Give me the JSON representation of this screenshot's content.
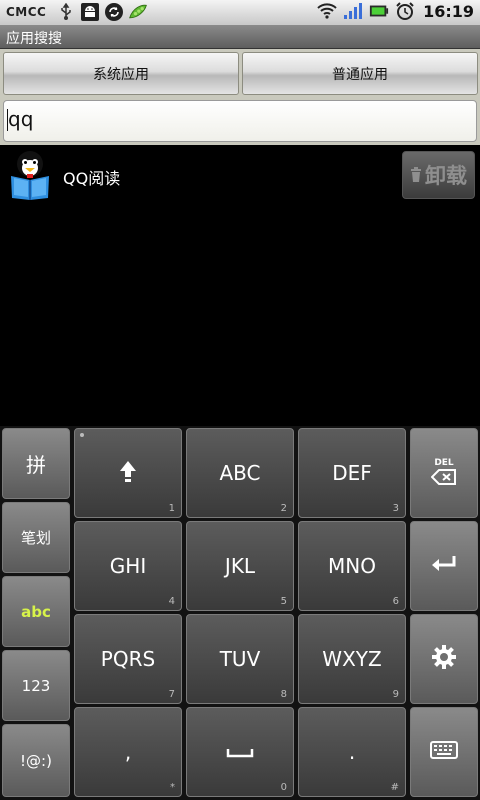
{
  "status_bar": {
    "carrier": "CMCC",
    "time": "16:19",
    "left_icons": [
      "usb-icon",
      "android-debug-icon",
      "sync-icon",
      "peapod-icon"
    ],
    "right_icons": [
      "wifi-icon",
      "signal-icon",
      "battery-icon",
      "alarm-icon"
    ]
  },
  "title_bar": {
    "title": "应用搜搜"
  },
  "tabs": [
    {
      "label": "系统应用"
    },
    {
      "label": "普通应用"
    }
  ],
  "search": {
    "value": "qq"
  },
  "results": [
    {
      "name": "QQ阅读",
      "icon": "qq-reader-icon",
      "action_label": "卸载",
      "action_icon": "trash-icon"
    }
  ],
  "keyboard": {
    "side_keys": [
      {
        "label": "拼"
      },
      {
        "label": "笔划"
      },
      {
        "label": "abc",
        "active": true
      },
      {
        "label": "123"
      },
      {
        "label": "!@:)"
      }
    ],
    "rows": [
      [
        {
          "label": "",
          "icon": "shift-icon",
          "sub": "1"
        },
        {
          "label": "ABC",
          "sub": "2"
        },
        {
          "label": "DEF",
          "sub": "3"
        }
      ],
      [
        {
          "label": "GHI",
          "sub": "4"
        },
        {
          "label": "JKL",
          "sub": "5"
        },
        {
          "label": "MNO",
          "sub": "6"
        }
      ],
      [
        {
          "label": "PQRS",
          "sub": "7"
        },
        {
          "label": "TUV",
          "sub": "8"
        },
        {
          "label": "WXYZ",
          "sub": "9"
        }
      ],
      [
        {
          "label": ",",
          "sub": "*"
        },
        {
          "label": "",
          "icon": "space-icon",
          "sub": "0"
        },
        {
          "label": ".",
          "sub": "#"
        }
      ]
    ],
    "right_keys": [
      {
        "label": "DEL",
        "icon": "delete-icon"
      },
      {
        "icon": "enter-icon"
      },
      {
        "icon": "settings-gear-icon"
      },
      {
        "icon": "keyboard-hide-icon"
      }
    ]
  },
  "colors": {
    "active_mode": "#d7f34a",
    "tab_bg": "#c9c9bd",
    "screen_bg": "#000000"
  }
}
